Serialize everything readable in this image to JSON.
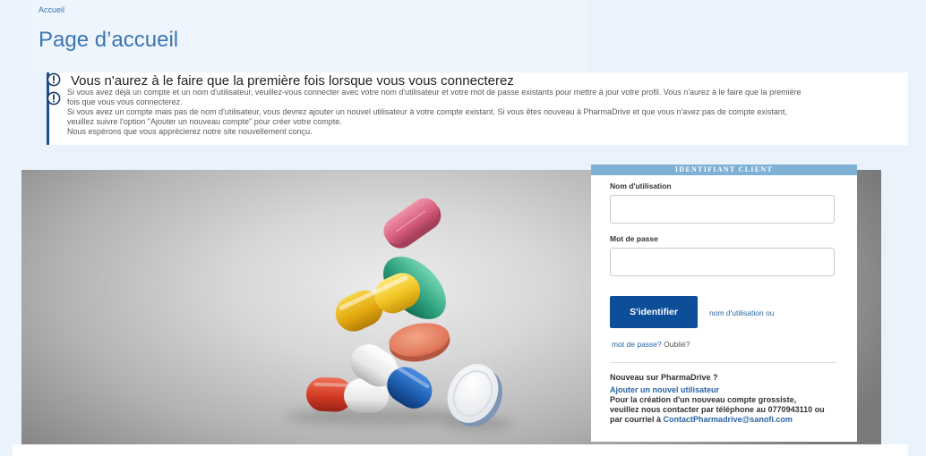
{
  "breadcrumb": {
    "label": "Accueil"
  },
  "page_title": "Page d’accueil",
  "notice": {
    "icon": "alert-circle-icon",
    "title": "Vous n'aurez à le faire que la première fois lorsque vous vous connecterez",
    "lines": [
      "Si vous avez déjà un compte et un nom d'utilisateur, veuillez-vous connecter avec votre nom d'utilisateur et votre mot de passe existants pour mettre à jour votre profil. Vous n'aurez à le faire que la première",
      "fois que vous vous connecterez.",
      "Si vous avez un compte mais pas de nom d'utilisateur, vous devrez ajouter un nouvel utilisateur à votre compte existant. Si vous êtes nouveau à PharmaDrive et que vous n'avez pas de compte existant,",
      "veuillez suivre l'option \"Ajouter un nouveau compte\" pour créer votre compte.",
      "Nous espérons que vous apprécierez notre site nouvellement conçu."
    ]
  },
  "login": {
    "header": "IDENTIFIANT CLIENT",
    "username_label": "Nom d'utilisation",
    "username_value": "",
    "password_label": "Mot de passe",
    "password_value": "",
    "submit_label": "S'identifier",
    "forgot_username_link": "nom d'utilisation",
    "or_label": "ou",
    "forgot_password_link": "mot de passe?",
    "forgot_suffix": "Oublié?",
    "new_heading": "Nouveau sur PharmaDrive ?",
    "add_user_link": "Ajouter un nouvel utilisateur",
    "contact_lines": [
      "Pour la création d'un nouveau compte grossiste,",
      "veuillez nous contacter par téléphone au 0770943110 ou"
    ],
    "contact_prefix": "par courriel à",
    "contact_email": "ContactPharmadrive@sanofi.com"
  },
  "colors": {
    "page_background": "#eaf3fb",
    "accent": "#3a76b3",
    "notice_border": "#1f4e8c",
    "login_header": "#7fb0d6",
    "button": "#0d4e99",
    "link": "#2a64a3"
  }
}
